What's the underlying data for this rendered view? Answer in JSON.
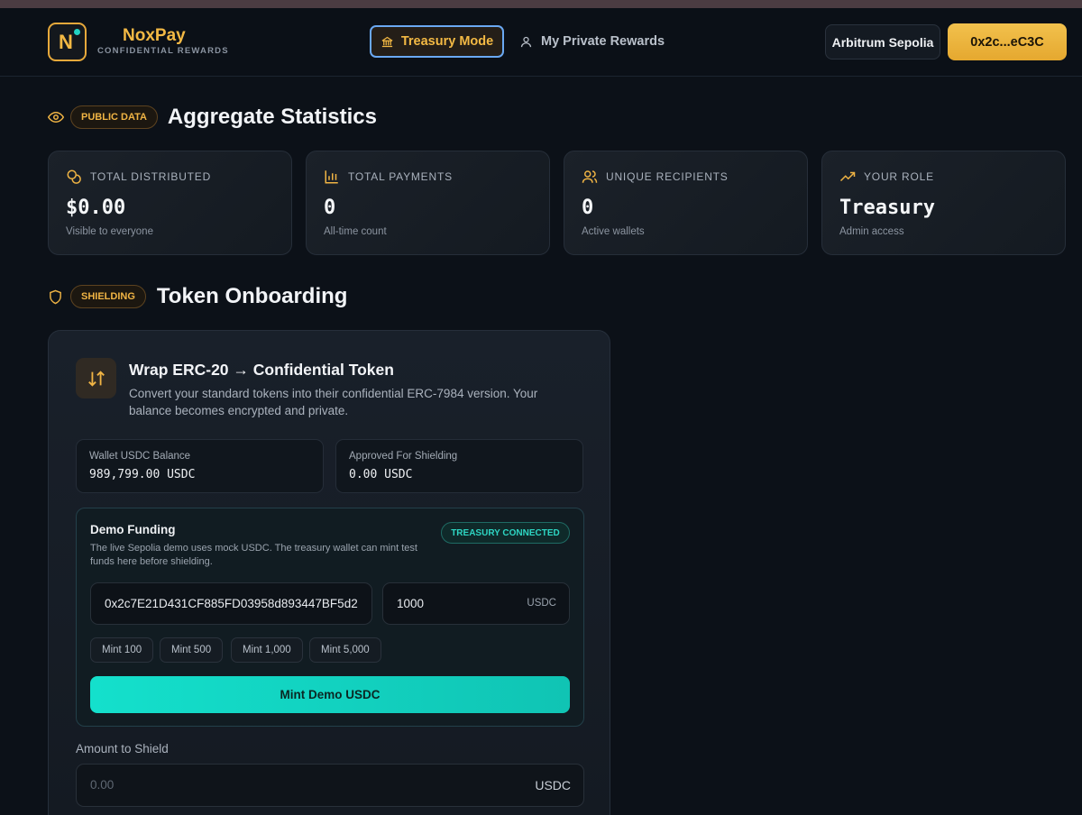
{
  "header": {
    "logo_letter": "N",
    "brand_name": "NoxPay",
    "brand_sub": "CONFIDENTIAL REWARDS",
    "tabs": [
      {
        "label": "Treasury Mode",
        "icon": "bank-icon",
        "active": true
      },
      {
        "label": "My Private Rewards",
        "icon": "user-icon",
        "active": false
      }
    ],
    "network": "Arbitrum Sepolia",
    "wallet": "0x2c...eC3C"
  },
  "stats_section": {
    "badge": "PUBLIC DATA",
    "title": "Aggregate Statistics",
    "cards": [
      {
        "icon": "coins-icon",
        "label": "TOTAL DISTRIBUTED",
        "value": "$0.00",
        "sub": "Visible to everyone"
      },
      {
        "icon": "bar-chart-icon",
        "label": "TOTAL PAYMENTS",
        "value": "0",
        "sub": "All-time count"
      },
      {
        "icon": "users-icon",
        "label": "UNIQUE RECIPIENTS",
        "value": "0",
        "sub": "Active wallets"
      },
      {
        "icon": "trending-up-icon",
        "label": "YOUR ROLE",
        "value": "Treasury",
        "sub": "Admin access"
      }
    ]
  },
  "onboarding_section": {
    "badge": "SHIELDING",
    "title": "Token Onboarding",
    "wrap": {
      "title": "Wrap ERC-20 → Confidential Token",
      "description": "Convert your standard tokens into their confidential ERC-7984 version. Your balance becomes encrypted and private.",
      "balances": [
        {
          "label": "Wallet USDC Balance",
          "value": "989,799.00 USDC"
        },
        {
          "label": "Approved For Shielding",
          "value": "0.00 USDC"
        }
      ],
      "demo": {
        "title": "Demo Funding",
        "description": "The live Sepolia demo uses mock USDC. The treasury wallet can mint test funds here before shielding.",
        "badge": "TREASURY CONNECTED",
        "address_value": "0x2c7E21D431CF885FD03958d893447BF5d2",
        "amount_value": "1000",
        "amount_unit": "USDC",
        "mint_options": [
          "Mint 100",
          "Mint 500",
          "Mint 1,000",
          "Mint 5,000"
        ],
        "mint_button": "Mint Demo USDC"
      },
      "shield": {
        "label": "Amount to Shield",
        "placeholder": "0.00",
        "unit": "USDC"
      }
    }
  },
  "colors": {
    "accent_gold": "#f3b944",
    "accent_teal": "#14e0cc",
    "background": "#0c1118",
    "active_tab_border": "#6aa8f2"
  }
}
